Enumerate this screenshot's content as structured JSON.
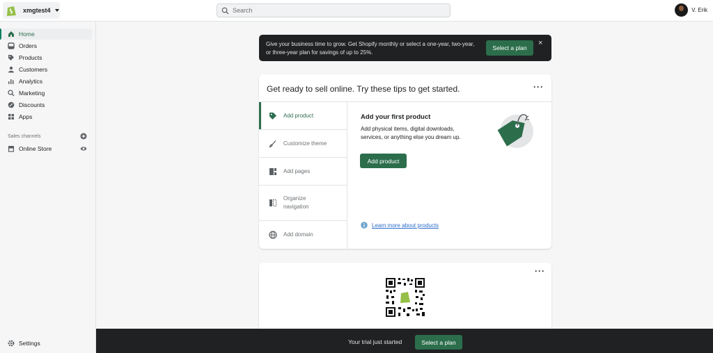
{
  "topbar": {
    "store_name": "xmgtest4",
    "search_placeholder": "Search",
    "user_name": "V. Erik"
  },
  "sidebar": {
    "items": [
      {
        "label": "Home",
        "icon": "home-icon"
      },
      {
        "label": "Orders",
        "icon": "orders-icon"
      },
      {
        "label": "Products",
        "icon": "tag-icon"
      },
      {
        "label": "Customers",
        "icon": "person-icon"
      },
      {
        "label": "Analytics",
        "icon": "bar-chart-icon"
      },
      {
        "label": "Marketing",
        "icon": "megaphone-icon"
      },
      {
        "label": "Discounts",
        "icon": "discount-icon"
      },
      {
        "label": "Apps",
        "icon": "apps-icon"
      }
    ],
    "sales_channels_label": "Sales channels",
    "online_store_label": "Online Store",
    "settings_label": "Settings"
  },
  "banner": {
    "text": "Give your business time to grow. Get Shopify monthly or select a one-year, two-year, or three-year plan for savings of up to 25%.",
    "button_label": "Select a plan",
    "close_label": "×"
  },
  "tips_card": {
    "title": "Get ready to sell online. Try these tips to get started.",
    "menu_label": "···",
    "tips": [
      {
        "label": "Add product",
        "icon": "tag-icon"
      },
      {
        "label": "Customize theme",
        "icon": "brush-icon"
      },
      {
        "label": "Add pages",
        "icon": "pages-icon"
      },
      {
        "label": "Organize navigation",
        "icon": "navigation-icon"
      },
      {
        "label": "Add domain",
        "icon": "globe-icon"
      }
    ],
    "active_tip": {
      "title": "Add your first product",
      "description": "Add physical items, digital downloads, services, or anything else you dream up.",
      "button_label": "Add product",
      "learn_more": "Learn more about products"
    }
  },
  "qr_card": {
    "menu_label": "···"
  },
  "trial_bar": {
    "text": "Your trial just started",
    "button_label": "Select a plan"
  },
  "colors": {
    "accent": "#2c6e4c",
    "dark": "#202123",
    "link": "#2c6ecb"
  }
}
